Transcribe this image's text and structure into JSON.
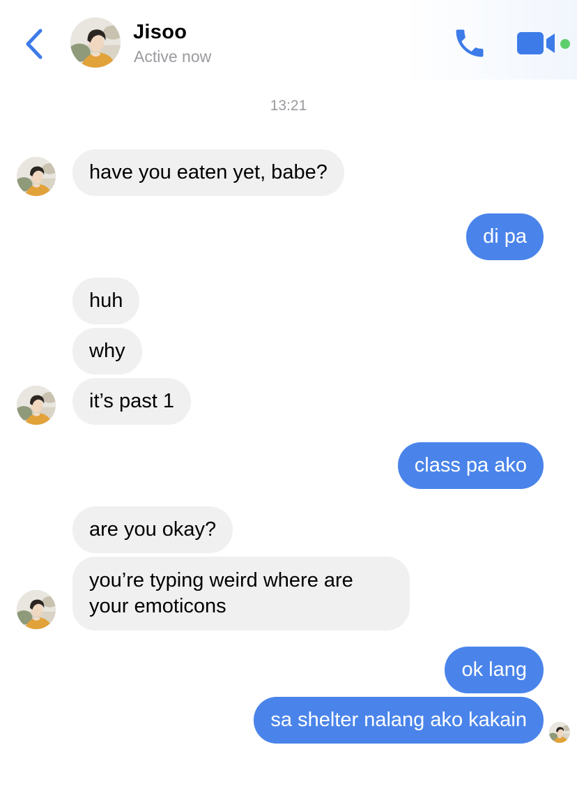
{
  "header": {
    "contact_name": "Jisoo",
    "status": "Active now",
    "accent_color": "#3d7be8",
    "online_color": "#5ccf6c"
  },
  "icons": {
    "back": "chevron-left-icon",
    "call": "phone-icon",
    "video": "video-camera-icon"
  },
  "conversation": {
    "timestamp": "13:21",
    "messages": [
      {
        "sender": "Jisoo",
        "direction": "incoming",
        "text": "have you eaten yet, babe?"
      },
      {
        "sender": "me",
        "direction": "outgoing",
        "text": "di pa"
      },
      {
        "sender": "Jisoo",
        "direction": "incoming",
        "text": "huh"
      },
      {
        "sender": "Jisoo",
        "direction": "incoming",
        "text": "why"
      },
      {
        "sender": "Jisoo",
        "direction": "incoming",
        "text": "it’s past 1"
      },
      {
        "sender": "me",
        "direction": "outgoing",
        "text": "class pa ako"
      },
      {
        "sender": "Jisoo",
        "direction": "incoming",
        "text": "are you okay?"
      },
      {
        "sender": "Jisoo",
        "direction": "incoming",
        "text": "you’re typing weird where are your emoticons"
      },
      {
        "sender": "me",
        "direction": "outgoing",
        "text": "ok lang"
      },
      {
        "sender": "me",
        "direction": "outgoing",
        "text": "sa shelter nalang ako kakain"
      }
    ]
  },
  "colors": {
    "incoming_bubble": "#f0f0f0",
    "outgoing_bubble": "#4a84ea",
    "muted_text": "#9a9a9f"
  }
}
